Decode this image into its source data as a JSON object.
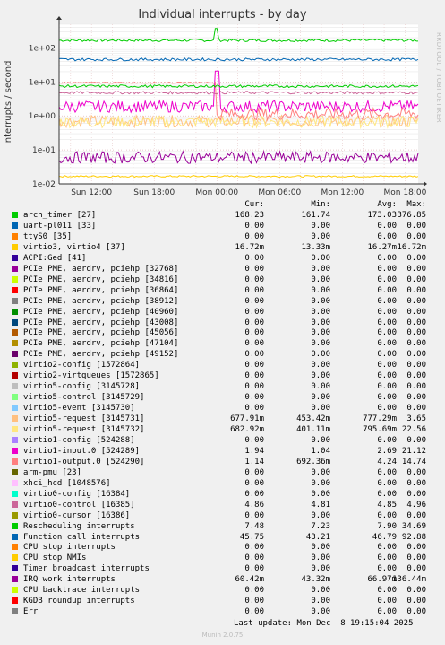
{
  "title": "Individual interrupts - by day",
  "side_label": "RRDTOOL / TOBI OETIKER",
  "footer": {
    "last_update": "Last update: Mon Dec  8 19:15:04 2025",
    "version": "Munin 2.0.75"
  },
  "legend_headers": [
    "Cur:",
    "Min:",
    "Avg:",
    "Max:"
  ],
  "chart_data": {
    "type": "line",
    "title": "Individual interrupts - by day",
    "ylabel": "interrupts / second",
    "yscale": "log",
    "ylim": [
      0.01,
      500
    ],
    "y_ticks": [
      {
        "label": "1e+02",
        "value": 100
      },
      {
        "label": "1e+01",
        "value": 10
      },
      {
        "label": "1e+00",
        "value": 1
      },
      {
        "label": "1e-01",
        "value": 0.1
      },
      {
        "label": "1e-02",
        "value": 0.01
      }
    ],
    "x_ticks": [
      "Sun 12:00",
      "Sun 18:00",
      "Mon 00:00",
      "Mon 06:00",
      "Mon 12:00",
      "Mon 18:00"
    ],
    "xlim_hours": [
      8.9,
      43.25
    ],
    "x_ticks_hours": [
      12,
      18,
      24,
      30,
      36,
      42
    ],
    "grid": true,
    "legend_position": "bottom",
    "series": [
      {
        "name": "arch_timer [27]",
        "color": "#00cc00",
        "values": {
          "cur": "168.23",
          "min": "161.74",
          "avg": "173.03",
          "max": "376.85"
        },
        "level": 168,
        "spike_at": 24.0,
        "spike_to": 376
      },
      {
        "name": "uart-pl011 [33]",
        "color": "#0066b3",
        "values": {
          "cur": "0.00",
          "min": "0.00",
          "avg": "0.00",
          "max": "0.00"
        }
      },
      {
        "name": "ttyS0 [35]",
        "color": "#ff8000",
        "values": {
          "cur": "0.00",
          "min": "0.00",
          "avg": "0.00",
          "max": "0.00"
        }
      },
      {
        "name": "virtio3, virtio4 [37]",
        "color": "#ffcc00",
        "values": {
          "cur": "16.72m",
          "min": "13.33m",
          "avg": "16.27m",
          "max": "16.72m"
        },
        "level": 0.0167
      },
      {
        "name": "ACPI:Ged [41]",
        "color": "#330099",
        "values": {
          "cur": "0.00",
          "min": "0.00",
          "avg": "0.00",
          "max": "0.00"
        }
      },
      {
        "name": "PCIe PME, aerdrv, pciehp [32768]",
        "color": "#990099",
        "values": {
          "cur": "0.00",
          "min": "0.00",
          "avg": "0.00",
          "max": "0.00"
        }
      },
      {
        "name": "PCIe PME, aerdrv, pciehp [34816]",
        "color": "#ccff00",
        "values": {
          "cur": "0.00",
          "min": "0.00",
          "avg": "0.00",
          "max": "0.00"
        }
      },
      {
        "name": "PCIe PME, aerdrv, pciehp [36864]",
        "color": "#ff0000",
        "values": {
          "cur": "0.00",
          "min": "0.00",
          "avg": "0.00",
          "max": "0.00"
        }
      },
      {
        "name": "PCIe PME, aerdrv, pciehp [38912]",
        "color": "#808080",
        "values": {
          "cur": "0.00",
          "min": "0.00",
          "avg": "0.00",
          "max": "0.00"
        }
      },
      {
        "name": "PCIe PME, aerdrv, pciehp [40960]",
        "color": "#008f00",
        "values": {
          "cur": "0.00",
          "min": "0.00",
          "avg": "0.00",
          "max": "0.00"
        }
      },
      {
        "name": "PCIe PME, aerdrv, pciehp [43008]",
        "color": "#00487d",
        "values": {
          "cur": "0.00",
          "min": "0.00",
          "avg": "0.00",
          "max": "0.00"
        }
      },
      {
        "name": "PCIe PME, aerdrv, pciehp [45056]",
        "color": "#b35a00",
        "values": {
          "cur": "0.00",
          "min": "0.00",
          "avg": "0.00",
          "max": "0.00"
        }
      },
      {
        "name": "PCIe PME, aerdrv, pciehp [47104]",
        "color": "#b38f00",
        "values": {
          "cur": "0.00",
          "min": "0.00",
          "avg": "0.00",
          "max": "0.00"
        }
      },
      {
        "name": "PCIe PME, aerdrv, pciehp [49152]",
        "color": "#6b006b",
        "values": {
          "cur": "0.00",
          "min": "0.00",
          "avg": "0.00",
          "max": "0.00"
        }
      },
      {
        "name": "virtio2-config [1572864]",
        "color": "#8fb300",
        "values": {
          "cur": "0.00",
          "min": "0.00",
          "avg": "0.00",
          "max": "0.00"
        }
      },
      {
        "name": "virtio2-virtqueues [1572865]",
        "color": "#b30000",
        "values": {
          "cur": "0.00",
          "min": "0.00",
          "avg": "0.00",
          "max": "0.00"
        }
      },
      {
        "name": "virtio5-config [3145728]",
        "color": "#bebebe",
        "values": {
          "cur": "0.00",
          "min": "0.00",
          "avg": "0.00",
          "max": "0.00"
        }
      },
      {
        "name": "virtio5-control [3145729]",
        "color": "#80ff80",
        "values": {
          "cur": "0.00",
          "min": "0.00",
          "avg": "0.00",
          "max": "0.00"
        }
      },
      {
        "name": "virtio5-event [3145730]",
        "color": "#80c9ff",
        "values": {
          "cur": "0.00",
          "min": "0.00",
          "avg": "0.00",
          "max": "0.00"
        }
      },
      {
        "name": "virtio5-request [3145731]",
        "color": "#ffc080",
        "values": {
          "cur": "677.91m",
          "min": "453.42m",
          "avg": "777.29m",
          "max": "3.65"
        },
        "level": 0.7
      },
      {
        "name": "virtio5-request [3145732]",
        "color": "#ffe680",
        "values": {
          "cur": "682.92m",
          "min": "401.11m",
          "avg": "795.69m",
          "max": "22.56"
        },
        "level": 0.68
      },
      {
        "name": "virtio1-config [524288]",
        "color": "#aa80ff",
        "values": {
          "cur": "0.00",
          "min": "0.00",
          "avg": "0.00",
          "max": "0.00"
        }
      },
      {
        "name": "virtio1-input.0 [524289]",
        "color": "#ee00cc",
        "values": {
          "cur": "1.94",
          "min": "1.04",
          "avg": "2.69",
          "max": "21.12"
        },
        "level": 1.9
      },
      {
        "name": "virtio1-output.0 [524290]",
        "color": "#ff8080",
        "values": {
          "cur": "1.14",
          "min": "692.36m",
          "avg": "4.24",
          "max": "14.74"
        },
        "level": 1.14
      },
      {
        "name": "arm-pmu [23]",
        "color": "#666600",
        "values": {
          "cur": "0.00",
          "min": "0.00",
          "avg": "0.00",
          "max": "0.00"
        }
      },
      {
        "name": "xhci_hcd [1048576]",
        "color": "#ffbfff",
        "values": {
          "cur": "0.00",
          "min": "0.00",
          "avg": "0.00",
          "max": "0.00"
        }
      },
      {
        "name": "virtio0-config [16384]",
        "color": "#00ffcc",
        "values": {
          "cur": "0.00",
          "min": "0.00",
          "avg": "0.00",
          "max": "0.00"
        }
      },
      {
        "name": "virtio0-control [16385]",
        "color": "#cc6699",
        "values": {
          "cur": "4.86",
          "min": "4.81",
          "avg": "4.85",
          "max": "4.96"
        },
        "level": 4.86
      },
      {
        "name": "virtio0-cursor [16386]",
        "color": "#999900",
        "values": {
          "cur": "0.00",
          "min": "0.00",
          "avg": "0.00",
          "max": "0.00"
        }
      },
      {
        "name": "Rescheduling interrupts",
        "color": "#00cc00",
        "values": {
          "cur": "7.48",
          "min": "7.23",
          "avg": "7.90",
          "max": "34.69"
        },
        "level": 7.5
      },
      {
        "name": "Function call interrupts",
        "color": "#0066b3",
        "values": {
          "cur": "45.75",
          "min": "43.21",
          "avg": "46.79",
          "max": "92.88"
        },
        "level": 45.8
      },
      {
        "name": "CPU stop interrupts",
        "color": "#ff8000",
        "values": {
          "cur": "0.00",
          "min": "0.00",
          "avg": "0.00",
          "max": "0.00"
        }
      },
      {
        "name": "CPU stop NMIs",
        "color": "#ffcc00",
        "values": {
          "cur": "0.00",
          "min": "0.00",
          "avg": "0.00",
          "max": "0.00"
        }
      },
      {
        "name": "Timer broadcast interrupts",
        "color": "#330099",
        "values": {
          "cur": "0.00",
          "min": "0.00",
          "avg": "0.00",
          "max": "0.00"
        }
      },
      {
        "name": "IRQ work interrupts",
        "color": "#990099",
        "values": {
          "cur": "60.42m",
          "min": "43.32m",
          "avg": "66.97m",
          "max": "136.44m"
        },
        "level": 0.06
      },
      {
        "name": "CPU backtrace interrupts",
        "color": "#ccff00",
        "values": {
          "cur": "0.00",
          "min": "0.00",
          "avg": "0.00",
          "max": "0.00"
        }
      },
      {
        "name": "KGDB roundup interrupts",
        "color": "#ff0000",
        "values": {
          "cur": "0.00",
          "min": "0.00",
          "avg": "0.00",
          "max": "0.00"
        }
      },
      {
        "name": "Err",
        "color": "#808080",
        "values": {
          "cur": "0.00",
          "min": "0.00",
          "avg": "0.00",
          "max": "0.00"
        }
      }
    ]
  }
}
